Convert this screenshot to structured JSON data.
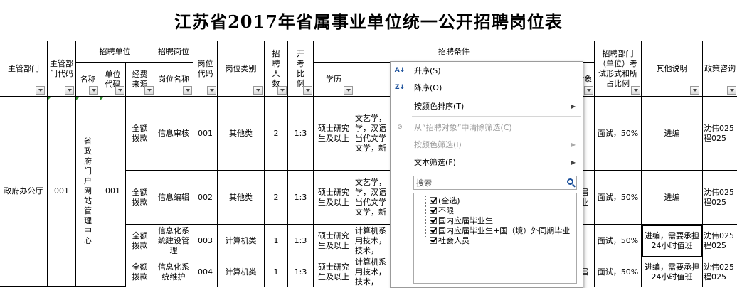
{
  "title": "江苏省2017年省属事业单位统一公开招聘岗位表",
  "headers": {
    "dept": "主管部门",
    "dept_code": "主管部门代码",
    "unit_group": "招聘单位",
    "unit_name": "名称",
    "unit_code": "单位代码",
    "fund": "经费来源",
    "post_group": "招聘岗位",
    "post_name": "岗位名称",
    "post_code": "岗位代码",
    "post_type": "岗位类别",
    "count": "招聘人数",
    "ratio": "开考比例",
    "cond_group": "招聘条件",
    "edu": "学历",
    "target": "对象",
    "exam": "招聘部门（单位）考试形式和所占比例",
    "other": "其他说明",
    "consult": "政策咨询"
  },
  "left_merged": {
    "dept": "政府办公厅",
    "dept_code": "001",
    "unit_name": "省政府门户网站管理中心",
    "unit_code": "001"
  },
  "rows": [
    {
      "fund": "全额拨款",
      "post": "信息审核",
      "code": "001",
      "type": "其他类",
      "count": "2",
      "ratio": "1:3",
      "edu": "硕士研究生及以上",
      "major": "文艺学，学，汉语当代文学文学，新",
      "target": "",
      "exam": "面试，50%",
      "other": "进编",
      "consult": "沈伟025程025"
    },
    {
      "fund": "全额拨款",
      "post": "信息编辑",
      "code": "002",
      "type": "其他类",
      "count": "2",
      "ratio": "1:3",
      "edu": "硕士研究生及以上",
      "major": "文艺学，学，汉语当代文学文学，新",
      "target": "届业",
      "exam": "面试，50%",
      "other": "进编",
      "consult": "沈伟025程025"
    },
    {
      "fund": "全额拨款",
      "post": "信息化系统建设管理",
      "code": "003",
      "type": "计算机类",
      "count": "1",
      "ratio": "1:3",
      "edu": "硕士研究生及以上",
      "major": "计算机系用技术，技术，",
      "target": "",
      "exam": "面试，50%",
      "other": "进编，需要承担24小时值班",
      "consult": "沈伟025程025"
    },
    {
      "fund": "全额拨款",
      "post": "信息化系统维护",
      "code": "004",
      "type": "计算机类",
      "count": "1",
      "ratio": "1:3",
      "edu": "硕士研究生及以上",
      "major": "计算机系用技术，技术，",
      "target": "届",
      "exam": "面试，50%",
      "other": "进编，需要承担24小时值班",
      "consult": "沈伟025程025"
    }
  ],
  "menu": {
    "sort_asc": "升序(S)",
    "sort_desc": "降序(O)",
    "sort_color": "按颜色排序(T)",
    "clear_filter": "从“招聘对象”中清除筛选(C)",
    "filter_color": "按颜色筛选(I)",
    "text_filter": "文本筛选(F)",
    "search_placeholder": "搜索",
    "items": [
      "(全选)",
      "不限",
      "国内应届毕业生",
      "国内应届毕业生+国（境）外同期毕业",
      "社会人员"
    ]
  }
}
